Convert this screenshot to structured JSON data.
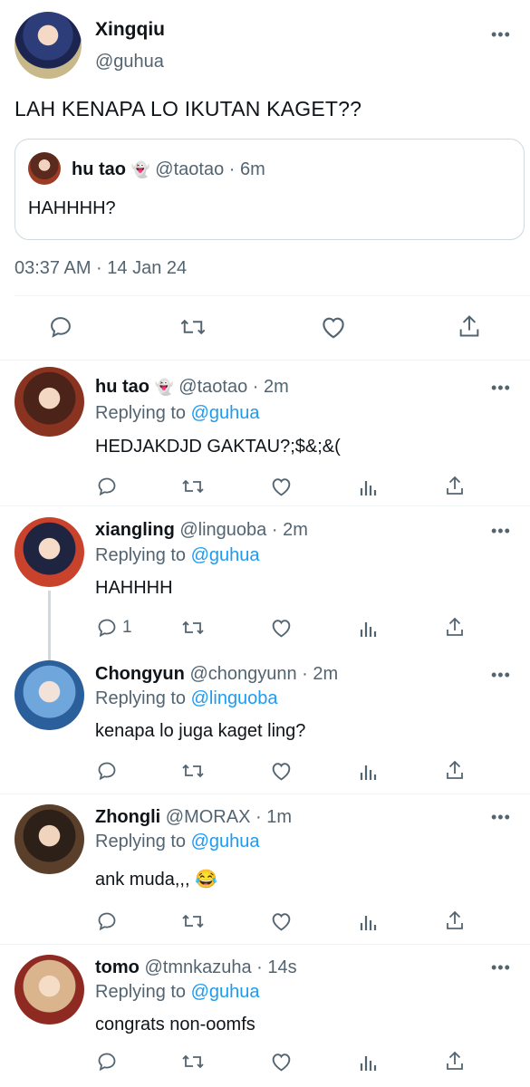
{
  "main_tweet": {
    "display_name": "Xingqiu",
    "handle": "@guhua",
    "text": "LAH KENAPA LO IKUTAN KAGET??",
    "quote": {
      "display_name": "hu tao",
      "emoji": "👻",
      "handle": "@taotao",
      "time": "· 6m",
      "text": "HAHHHH?"
    },
    "timestamp": "03:37 AM · 14 Jan 24"
  },
  "replies": [
    {
      "display_name": "hu tao",
      "emoji": "👻",
      "handle": "@taotao",
      "time": "· 2m",
      "replying_label": "Replying to",
      "replying_to": "@guhua",
      "text": "HEDJAKDJD GAKTAU?;$&;&(",
      "reply_count": ""
    },
    {
      "display_name": "xiangling",
      "emoji": "",
      "handle": "@linguoba",
      "time": "· 2m",
      "replying_label": "Replying to",
      "replying_to": "@guhua",
      "text": "HAHHHH",
      "reply_count": "1"
    },
    {
      "display_name": "Chongyun",
      "emoji": "",
      "handle": "@chongyunn",
      "time": "· 2m",
      "replying_label": "Replying to",
      "replying_to": "@linguoba",
      "text": "kenapa lo juga kaget ling?",
      "reply_count": ""
    },
    {
      "display_name": "Zhongli",
      "emoji": "",
      "handle": "@MORAX",
      "time": "· 1m",
      "replying_label": "Replying to",
      "replying_to": "@guhua",
      "text": "ank muda,,, 😂",
      "reply_count": ""
    },
    {
      "display_name": "tomo",
      "emoji": "",
      "handle": "@tmnkazuha",
      "time": "· 14s",
      "replying_label": "Replying to",
      "replying_to": "@guhua",
      "text": "congrats non-oomfs",
      "reply_count": ""
    }
  ],
  "icons": {
    "more": "more-horizontal-icon",
    "reply": "reply-icon",
    "retweet": "retweet-icon",
    "like": "heart-icon",
    "views": "views-icon",
    "share": "share-icon"
  },
  "colors": {
    "text": "#0f1419",
    "muted": "#536471",
    "link": "#1d9bf0",
    "divider": "#eff3f4"
  },
  "more_glyph": "•••"
}
